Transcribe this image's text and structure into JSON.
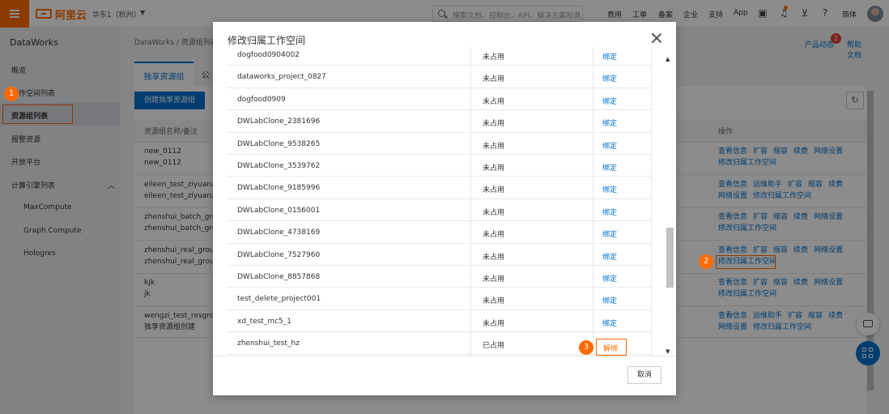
{
  "topbar": {
    "logo_text": "阿里云",
    "region": "华东1（杭州）",
    "search_placeholder": "搜索文档、控制台、API、解决方案和资源",
    "nav": [
      "费用",
      "工单",
      "备案",
      "企业",
      "支持",
      "App"
    ],
    "language": "简体"
  },
  "sidebar": {
    "title": "DataWorks",
    "items": [
      "概览",
      "工作空间列表",
      "资源组列表",
      "报警资源",
      "开放平台",
      "计算引擎列表"
    ],
    "engines": [
      "MaxCompute",
      "Graph Compute",
      "Hologres"
    ]
  },
  "main": {
    "breadcrumb": "DataWorks  /  资源组列表",
    "product_news": "产品动态",
    "news_count": "2",
    "help_doc": "帮助文档",
    "tab_exclusive": "独享资源组",
    "tab_public": "公",
    "create_button": "创建独享资源组",
    "col_name": "资源组名称/备注",
    "col_actions": "操作",
    "rows": [
      {
        "name": "new_0112",
        "note": "new_0112",
        "actions": [
          "查看信息",
          "扩容",
          "缩容",
          "续费",
          "网络设置",
          "修改归属工作空间"
        ]
      },
      {
        "name": "eileen_test_ziyuanzu",
        "note": "eileen_test_ziyuanzu",
        "actions": [
          "查看信息",
          "运维助手",
          "扩容",
          "缩容",
          "续费",
          "网络设置",
          "修改归属工作空间"
        ]
      },
      {
        "name": "zhenshui_batch_group",
        "note": "zhenshui_batch_group",
        "actions": [
          "查看信息",
          "扩容",
          "缩容",
          "续费",
          "网络设置",
          "修改归属工作空间"
        ]
      },
      {
        "name": "zhenshui_real_group",
        "note": "zhenshui_real_group",
        "actions": [
          "查看信息",
          "扩容",
          "缩容",
          "续费",
          "网络设置",
          "修改归属工作空间"
        ]
      },
      {
        "name": "kjk",
        "note": "jk",
        "actions": [
          "查看信息",
          "扩容",
          "缩容",
          "续费",
          "网络设置",
          "修改归属工作空间"
        ]
      },
      {
        "name": "wengzi_test_resgroup",
        "note": "独享资源组创建",
        "actions": [
          "查看信息",
          "运维助手",
          "扩容",
          "缩容",
          "续费",
          "网络设置",
          "修改归属工作空间"
        ]
      }
    ]
  },
  "modal": {
    "title": "修改归属工作空间",
    "rows": [
      {
        "name": "dogfood0904002",
        "status": "未占用",
        "action": "绑定"
      },
      {
        "name": "dataworks_project_0827",
        "status": "未占用",
        "action": "绑定"
      },
      {
        "name": "dogfood0909",
        "status": "未占用",
        "action": "绑定"
      },
      {
        "name": "DWLabClone_2381696",
        "status": "未占用",
        "action": "绑定"
      },
      {
        "name": "DWLabClone_9538265",
        "status": "未占用",
        "action": "绑定"
      },
      {
        "name": "DWLabClone_3539762",
        "status": "未占用",
        "action": "绑定"
      },
      {
        "name": "DWLabClone_9185996",
        "status": "未占用",
        "action": "绑定"
      },
      {
        "name": "DWLabClone_0156001",
        "status": "未占用",
        "action": "绑定"
      },
      {
        "name": "DWLabClone_4738169",
        "status": "未占用",
        "action": "绑定"
      },
      {
        "name": "DWLabClone_7527960",
        "status": "未占用",
        "action": "绑定"
      },
      {
        "name": "DWLabClone_8857868",
        "status": "未占用",
        "action": "绑定"
      },
      {
        "name": "test_delete_project001",
        "status": "未占用",
        "action": "绑定"
      },
      {
        "name": "xd_test_mc5_1",
        "status": "未占用",
        "action": "绑定"
      },
      {
        "name": "zhenshui_test_hz",
        "status": "已占用",
        "action": "解绑"
      }
    ],
    "cancel": "取消"
  },
  "steps": [
    "1",
    "2",
    "3"
  ],
  "colors": {
    "brand": "#ff6a00",
    "link": "#0070cc",
    "badge": "#e23c39"
  }
}
